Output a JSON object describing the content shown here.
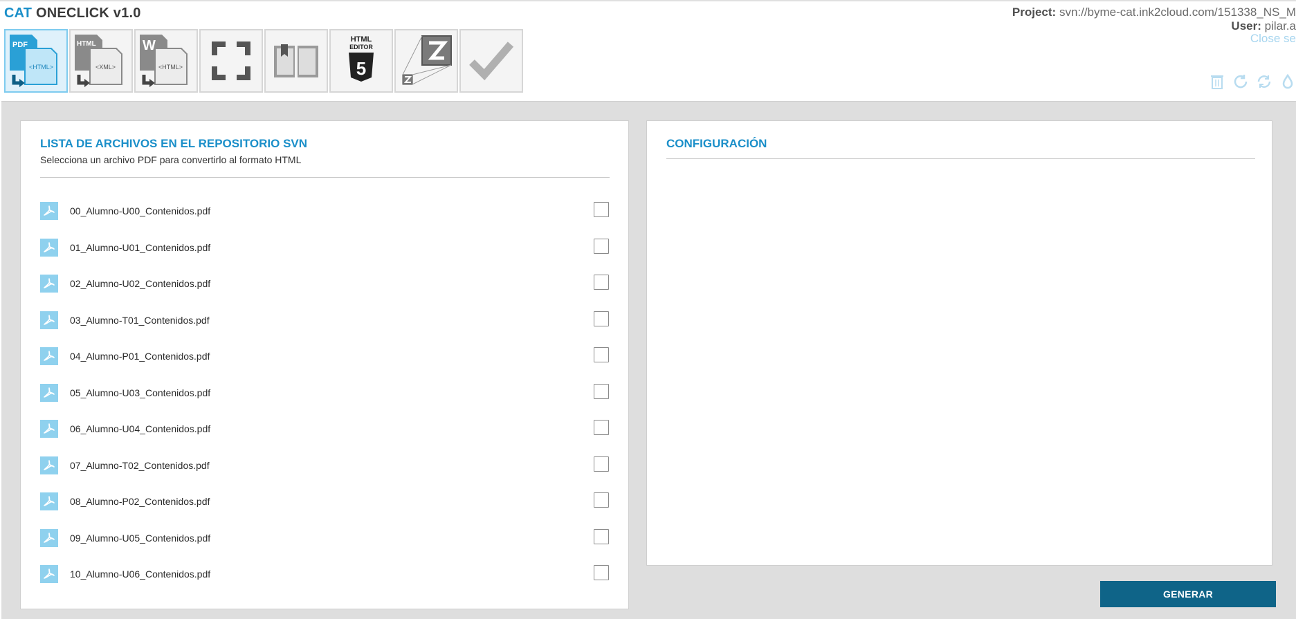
{
  "header": {
    "brand_accent": "CAT",
    "brand_rest": "ONECLICK v1.0",
    "project_label": "Project:",
    "project_value": "svn://byme-cat.ink2cloud.com/151338_NS_M",
    "user_label": "User:",
    "user_value": "pilar.a",
    "close_session": "Close se",
    "utility_icons": [
      "trash-icon",
      "refresh-icon",
      "sync-icon",
      "droplet-icon"
    ]
  },
  "toolbar": {
    "tools": [
      {
        "name": "pdf-to-html",
        "icon": "pdf-to-html-icon",
        "labels": [
          "PDF",
          "<HTML>"
        ],
        "active": true
      },
      {
        "name": "html-to-xml",
        "icon": "html-to-xml-icon",
        "labels": [
          "HTML",
          "<XML>"
        ],
        "active": false
      },
      {
        "name": "word-to-html",
        "icon": "word-to-html-icon",
        "labels": [
          "W",
          "<HTML>"
        ],
        "active": false
      },
      {
        "name": "fullscreen",
        "icon": "fullscreen-icon",
        "labels": [],
        "active": false
      },
      {
        "name": "book",
        "icon": "book-icon",
        "labels": [],
        "active": false
      },
      {
        "name": "html-editor",
        "icon": "html5-editor-icon",
        "labels": [
          "HTML",
          "EDITOR",
          "5"
        ],
        "active": false
      },
      {
        "name": "zoom",
        "icon": "zoom-z-icon",
        "labels": [],
        "active": false
      },
      {
        "name": "validate",
        "icon": "checkmark-icon",
        "labels": [],
        "active": false
      }
    ]
  },
  "files_panel": {
    "title": "LISTA DE ARCHIVOS EN EL REPOSITORIO SVN",
    "subtitle": "Selecciona un archivo PDF para convertirlo al formato HTML",
    "files": [
      {
        "name": "00_Alumno-U00_Contenidos.pdf",
        "checked": false
      },
      {
        "name": "01_Alumno-U01_Contenidos.pdf",
        "checked": false
      },
      {
        "name": "02_Alumno-U02_Contenidos.pdf",
        "checked": false
      },
      {
        "name": "03_Alumno-T01_Contenidos.pdf",
        "checked": false
      },
      {
        "name": "04_Alumno-P01_Contenidos.pdf",
        "checked": false
      },
      {
        "name": "05_Alumno-U03_Contenidos.pdf",
        "checked": false
      },
      {
        "name": "06_Alumno-U04_Contenidos.pdf",
        "checked": false
      },
      {
        "name": "07_Alumno-T02_Contenidos.pdf",
        "checked": false
      },
      {
        "name": "08_Alumno-P02_Contenidos.pdf",
        "checked": false
      },
      {
        "name": "09_Alumno-U05_Contenidos.pdf",
        "checked": false
      },
      {
        "name": "10_Alumno-U06_Contenidos.pdf",
        "checked": false
      }
    ]
  },
  "config_panel": {
    "title": "CONFIGURACIÓN"
  },
  "actions": {
    "generate_label": "GENERAR"
  },
  "colors": {
    "accent": "#1b8fc9",
    "button": "#0f6488",
    "workspace_bg": "#dedede",
    "pdf_icon_bg": "#8fd1ee"
  }
}
